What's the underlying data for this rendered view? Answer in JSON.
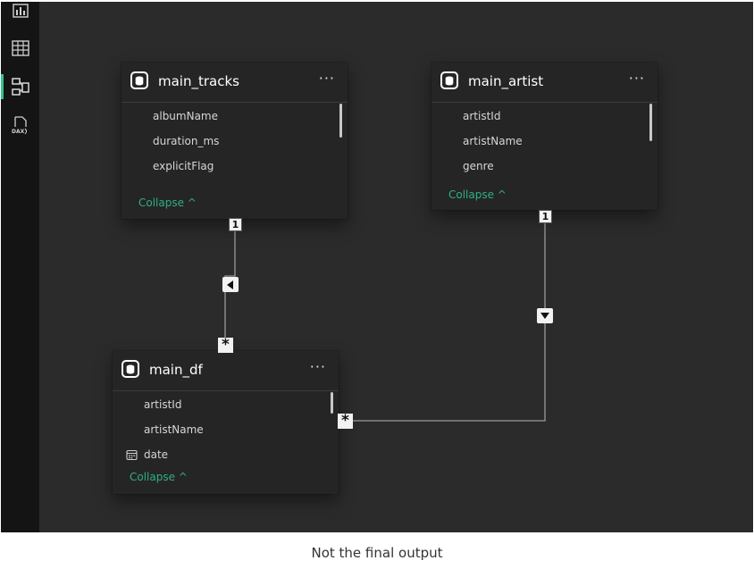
{
  "sidebar": {
    "items": [
      {
        "icon": "report-view-icon"
      },
      {
        "icon": "table-view-icon"
      },
      {
        "icon": "model-view-icon",
        "active": true
      },
      {
        "icon": "dax-query-icon",
        "label": "DAX"
      }
    ]
  },
  "tables": {
    "main_tracks": {
      "title": "main_tracks",
      "more": "···",
      "fields": [
        "albumName",
        "duration_ms",
        "explicitFlag"
      ],
      "collapse": "Collapse ^"
    },
    "main_artist": {
      "title": "main_artist",
      "more": "···",
      "fields": [
        "artistId",
        "artistName",
        "genre"
      ],
      "collapse": "Collapse ^"
    },
    "main_df": {
      "title": "main_df",
      "more": "···",
      "fields": [
        "artistId",
        "artistName",
        "date"
      ],
      "collapse": "Collapse ^"
    }
  },
  "relationships": [
    {
      "from": "main_tracks",
      "to": "main_df",
      "one_label": "1",
      "many_label": "*",
      "filter_direction": "left-arrow-icon"
    },
    {
      "from": "main_artist",
      "to": "main_df",
      "one_label": "1",
      "many_label": "*",
      "filter_direction": "down-arrow-icon"
    }
  ],
  "caption": "Not the final output",
  "colors": {
    "accent": "#2fae84",
    "active_indicator": "#33c48d",
    "canvas": "#2b2b2b",
    "card": "#252525"
  }
}
